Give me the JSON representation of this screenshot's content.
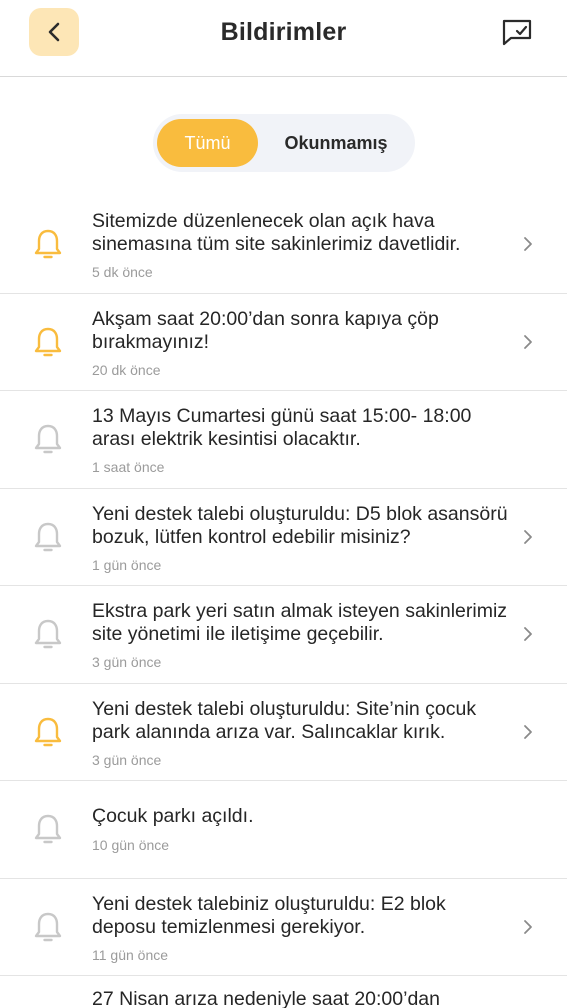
{
  "header": {
    "title": "Bildirimler",
    "back_icon": "chevron-left-icon",
    "action_icon": "message-check-icon"
  },
  "tabs": [
    {
      "label": "Tümü",
      "active": true
    },
    {
      "label": "Okunmamış",
      "active": false
    }
  ],
  "colors": {
    "accent": "#F9BC3E",
    "accent_light": "#FDE6B6",
    "unread_bell": "#F9BC3E",
    "read_bell": "#C8C8C8",
    "tabs_bg": "#F1F3F8"
  },
  "notifications": [
    {
      "message": "Sitemizde düzenlenecek olan açık hava sinemasına tüm site sakinlerimiz davetlidir.",
      "time": "5 dk önce",
      "unread": true,
      "has_chevron": true
    },
    {
      "message": "Akşam saat 20:00’dan sonra kapıya çöp bırakmayınız!",
      "time": "20 dk önce",
      "unread": true,
      "has_chevron": true
    },
    {
      "message": "13 Mayıs Cumartesi günü saat 15:00- 18:00 arası elektrik kesintisi olacaktır.",
      "time": "1 saat önce",
      "unread": false,
      "has_chevron": false
    },
    {
      "message": "Yeni destek talebi oluşturuldu: D5 blok asansörü bozuk, lütfen kontrol edebilir misiniz?",
      "time": "1 gün önce",
      "unread": false,
      "has_chevron": true
    },
    {
      "message": "Ekstra park yeri satın almak isteyen sakinlerimiz site yönetimi ile iletişime geçebilir.",
      "time": "3 gün önce",
      "unread": false,
      "has_chevron": true
    },
    {
      "message": "Yeni destek talebi oluşturuldu: Site’nin çocuk park alanında arıza var. Salıncaklar kırık.",
      "time": "3 gün önce",
      "unread": true,
      "has_chevron": true
    },
    {
      "message": "Çocuk parkı açıldı.",
      "time": "10 gün önce",
      "unread": false,
      "has_chevron": false
    },
    {
      "message": "Yeni destek talebiniz oluşturuldu: E2 blok deposu temizlenmesi gerekiyor.",
      "time": "11 gün önce",
      "unread": false,
      "has_chevron": true
    },
    {
      "message": "27 Nisan arıza nedeniyle saat 20:00’dan",
      "time": "",
      "unread": false,
      "has_chevron": false
    }
  ]
}
